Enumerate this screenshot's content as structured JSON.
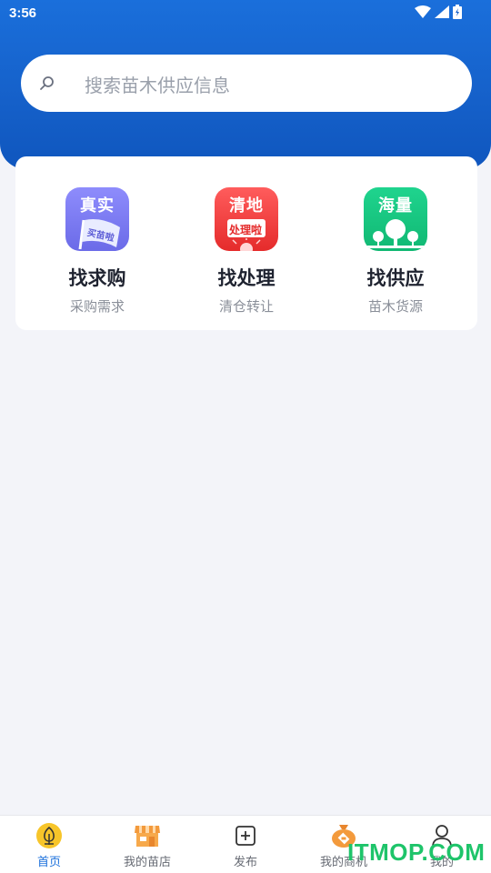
{
  "status_bar": {
    "time": "3:56"
  },
  "search": {
    "placeholder": "搜索苗木供应信息"
  },
  "categories": [
    {
      "tile_text": "真实",
      "flag_text": "买苗啦",
      "title": "找求购",
      "subtitle": "采购需求",
      "icon": "flag-icon"
    },
    {
      "tile_text": "清地",
      "flag_text": "处理啦",
      "title": "找处理",
      "subtitle": "清仓转让",
      "icon": "sun-icon"
    },
    {
      "tile_text": "海量",
      "title": "找供应",
      "subtitle": "苗木货源",
      "icon": "trees-icon"
    }
  ],
  "tabbar": {
    "items": [
      {
        "label": "首页",
        "icon": "home-tree-icon",
        "active": true
      },
      {
        "label": "我的苗店",
        "icon": "store-icon",
        "active": false
      },
      {
        "label": "发布",
        "icon": "plus-square-icon",
        "active": false
      },
      {
        "label": "我的商机",
        "icon": "money-bag-icon",
        "active": false
      },
      {
        "label": "我的",
        "icon": "user-icon",
        "active": false
      }
    ]
  },
  "watermark": "ITMOP.COM",
  "colors": {
    "primary": "#1a6fdb",
    "tab_active": "#1a6fdb",
    "background": "#f3f4f9"
  }
}
